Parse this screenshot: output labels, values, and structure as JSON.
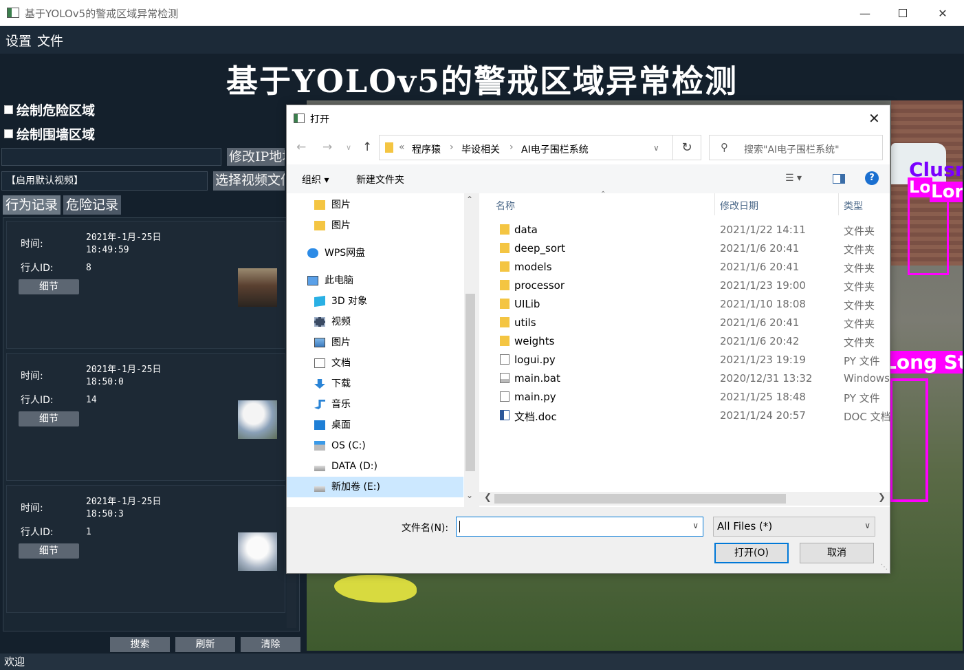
{
  "window": {
    "title": "基于YOLOv5的警戒区域异常检测"
  },
  "menu": {
    "items": [
      "设置",
      "文件"
    ]
  },
  "header": {
    "title": "基于YOLOv5的警戒区域异常检测"
  },
  "controls": {
    "draw_danger": "绘制危险区域",
    "draw_fence": "绘制围墙区域",
    "ip_button": "修改IP地址",
    "video_select_value": "【启用默认视频】",
    "choose_video_button": "选择视频文件"
  },
  "tabs": [
    "行为记录",
    "危险记录"
  ],
  "records": [
    {
      "time_label": "时间:",
      "date": "2021年-1月-25日",
      "time": "18:49:59",
      "id_label": "行人ID:",
      "id": "8",
      "detail": "细节"
    },
    {
      "time_label": "时间:",
      "date": "2021年-1月-25日",
      "time": "18:50:0",
      "id_label": "行人ID:",
      "id": "14",
      "detail": "细节"
    },
    {
      "time_label": "时间:",
      "date": "2021年-1月-25日",
      "time": "18:50:3",
      "id_label": "行人ID:",
      "id": "1",
      "detail": "细节"
    }
  ],
  "bottom_buttons": [
    "搜索",
    "刷新",
    "清除"
  ],
  "status": "欢迎",
  "video_overlay": {
    "labels": [
      "Clusr",
      "Lo",
      "Lor",
      "Long St"
    ]
  },
  "dialog": {
    "title": "打开",
    "path": {
      "prefix": "«",
      "segments": [
        "程序猿",
        "毕设相关",
        "AI电子围栏系统"
      ]
    },
    "search_placeholder": "搜索\"AI电子围栏系统\"",
    "toolbar": {
      "organize": "组织 ▾",
      "new_folder": "新建文件夹"
    },
    "nav_items": [
      {
        "label": "图片",
        "icon": "folder-icon",
        "indent": 1
      },
      {
        "label": "图片",
        "icon": "folder-icon",
        "indent": 1
      },
      {
        "label": "WPS网盘",
        "icon": "cloud-icon",
        "indent": 0
      },
      {
        "label": "此电脑",
        "icon": "pc-icon",
        "indent": 0
      },
      {
        "label": "3D 对象",
        "icon": "cube-icon",
        "indent": 1
      },
      {
        "label": "视频",
        "icon": "film-icon",
        "indent": 1
      },
      {
        "label": "图片",
        "icon": "picture-icon",
        "indent": 1
      },
      {
        "label": "文档",
        "icon": "document-icon",
        "indent": 1
      },
      {
        "label": "下载",
        "icon": "download-icon",
        "indent": 1
      },
      {
        "label": "音乐",
        "icon": "music-icon",
        "indent": 1
      },
      {
        "label": "桌面",
        "icon": "desktop-icon",
        "indent": 1
      },
      {
        "label": "OS (C:)",
        "icon": "drive-os-icon",
        "indent": 1
      },
      {
        "label": "DATA (D:)",
        "icon": "drive-icon",
        "indent": 1
      },
      {
        "label": "新加卷 (E:)",
        "icon": "drive-icon",
        "indent": 1,
        "selected": true
      }
    ],
    "columns": {
      "name": "名称",
      "date": "修改日期",
      "type": "类型"
    },
    "files": [
      {
        "name": "data",
        "date": "2021/1/22 14:11",
        "type": "文件夹",
        "icon": "folder-icon"
      },
      {
        "name": "deep_sort",
        "date": "2021/1/6 20:41",
        "type": "文件夹",
        "icon": "folder-icon"
      },
      {
        "name": "models",
        "date": "2021/1/6 20:41",
        "type": "文件夹",
        "icon": "folder-icon"
      },
      {
        "name": "processor",
        "date": "2021/1/23 19:00",
        "type": "文件夹",
        "icon": "folder-icon"
      },
      {
        "name": "UILib",
        "date": "2021/1/10 18:08",
        "type": "文件夹",
        "icon": "folder-icon"
      },
      {
        "name": "utils",
        "date": "2021/1/6 20:41",
        "type": "文件夹",
        "icon": "folder-icon"
      },
      {
        "name": "weights",
        "date": "2021/1/6 20:42",
        "type": "文件夹",
        "icon": "folder-icon"
      },
      {
        "name": "logui.py",
        "date": "2021/1/23 19:19",
        "type": "PY 文件",
        "icon": "file-icon"
      },
      {
        "name": "main.bat",
        "date": "2020/12/31 13:32",
        "type": "Windows",
        "icon": "bat-file-icon"
      },
      {
        "name": "main.py",
        "date": "2021/1/25 18:48",
        "type": "PY 文件",
        "icon": "file-icon"
      },
      {
        "name": "文档.doc",
        "date": "2021/1/24 20:57",
        "type": "DOC 文档",
        "icon": "doc-file-icon"
      }
    ],
    "filename_label": "文件名(N):",
    "filename_value": "",
    "filter_value": "All Files (*)",
    "open_button": "打开(O)",
    "cancel_button": "取消"
  }
}
